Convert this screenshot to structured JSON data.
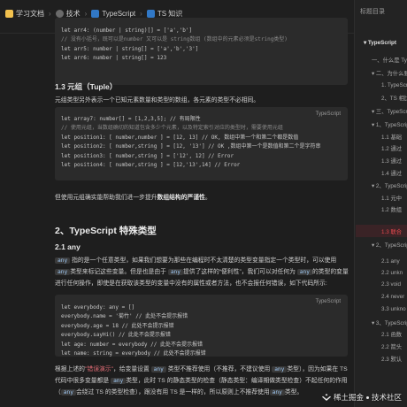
{
  "breadcrumb": {
    "items": [
      {
        "label": "学习文档",
        "icon": "notebook-icon",
        "color": "#f2c14e"
      },
      {
        "label": "技术",
        "icon": "gear-icon",
        "color": "#8a8a8a"
      },
      {
        "label": "TypeScript",
        "icon": "ts-icon",
        "color": "#3178c6"
      },
      {
        "label": "TS 知识",
        "icon": "folder-icon",
        "color": "#3178c6"
      }
    ]
  },
  "code1": {
    "lang": "",
    "lines": [
      "let arr4: (number | string)[] = ['a','b']",
      "// 没有小括号，既可以是number 又可以是 string数组 (数组中的元素必须是string类型)",
      "let arr5: number | string[] = ['a','b','3']",
      "let arr6: number | string[] = 123"
    ]
  },
  "section_tuple": {
    "heading": "1.3 元组（Tuple）",
    "desc": "元组类型另外表示一个已知元素数量和类型的数组，各元素的类型不必相同。"
  },
  "code2": {
    "lang": "TypeScript",
    "lines": [
      "let array7: number[] = [1,2,3,5]; // 有局限性",
      "",
      "// 使用元组，当数组确切的知道包含多少个元素，以及特定索引对应的类型时，需要使用元组",
      "let position1: [ number,number ] = [12, 13] // OK, 数组中第一个和第二个都是数值",
      "let position2: [ number,string ] = [12, '13'] // OK ,数组中第一个是数值和第二个是字符串",
      "let position3: [ number,string ] = ['12', 12] // Error",
      "let position4: [ number,string ] = [12,'13',14] // Error"
    ]
  },
  "tuple_note": {
    "before": "但使用元组确实能帮助我们进一步提升",
    "bold": "数组结构的严谨性",
    "after": "。"
  },
  "section_special": {
    "heading": "2、TypeScript 特殊类型"
  },
  "section_any": {
    "heading": "2.1 any",
    "p_a": "指的是一个任意类型，如果我们想要为那些在编程时不太清楚的类型变量指定一个类型时，可以使用",
    "p_b": "类型来标记这些变量。但是也是由于",
    "p_c": "提供了这样的“便利性”，我们可以对任何为",
    "p_d": "的类型的变量进行任何操作，即使是在获取该类型的变量中没有的属性或者方法，也不会报任何错误，如下代码所示:",
    "tag": "any"
  },
  "code3": {
    "lang": "TypeScript",
    "lines": [
      "let everybody: any = []",
      "everybody.name = '菊竹' // 此处不会提示报错",
      "everybody.age = 18 // 此处不会提示报错",
      "everybody.sayHi() // 此处不会提示报错",
      "let age: number = everybody // 此处不会提示报错",
      "let name: string = everybody // 此处不会提示报错"
    ]
  },
  "any_note": {
    "a": "根据上述的",
    "red": "\"错误演示\"",
    "b": "，给变量设置",
    "c": "类型不推荐使用（不推荐，不建议使用",
    "d": "类型），因为如果在 TS 代码中很多变量都是",
    "e": "类型，此时 TS 的静态类型的检查（静态类型：编译期做类型检查）不起任何的作用（",
    "f": "会绕过 TS 的类型检查），跟没有用 TS 是一样的，所以原则上不推荐使用",
    "g": "类型。",
    "tag": "any"
  },
  "toc": {
    "title": "标题目录",
    "items": [
      {
        "label": "▾ TypeScript",
        "style": "strong"
      },
      {
        "label": "一、什么是 TypeScript",
        "style": ""
      },
      {
        "label": "▾ 二、为什么要学习",
        "style": ""
      },
      {
        "label": "1. TypeScript",
        "style": ""
      },
      {
        "label": "2、TS 相比",
        "style": ""
      },
      {
        "label": "▾ 三、TypeScript",
        "style": ""
      },
      {
        "label": "▾ 1、TypeScript",
        "style": ""
      },
      {
        "label": "1.1 基础",
        "style": ""
      },
      {
        "label": "1.2 通过",
        "style": ""
      },
      {
        "label": "1.3 通过",
        "style": ""
      },
      {
        "label": "1.4 通过",
        "style": ""
      },
      {
        "label": "▾ 2、TypeScript",
        "style": ""
      },
      {
        "label": "1.1 元中",
        "style": ""
      },
      {
        "label": "1.2 数组",
        "style": ""
      },
      {
        "label": "1.3 联合",
        "style": "active"
      },
      {
        "label": "▾ 2、TypeScript",
        "style": ""
      },
      {
        "label": "2.1 any",
        "style": ""
      },
      {
        "label": "2.2 unkn",
        "style": ""
      },
      {
        "label": "2.3 void",
        "style": ""
      },
      {
        "label": "2.4 never",
        "style": ""
      },
      {
        "label": "3.3 unkno",
        "style": ""
      },
      {
        "label": "▾ 3、TypeScript",
        "style": ""
      },
      {
        "label": "2.1 函数",
        "style": ""
      },
      {
        "label": "2.2 箭头",
        "style": ""
      },
      {
        "label": "2.3 默认",
        "style": ""
      }
    ]
  },
  "watermark": {
    "brand": "稀土掘金",
    "suffix": "技术社区",
    "text": "稀土掘金技术社区"
  }
}
